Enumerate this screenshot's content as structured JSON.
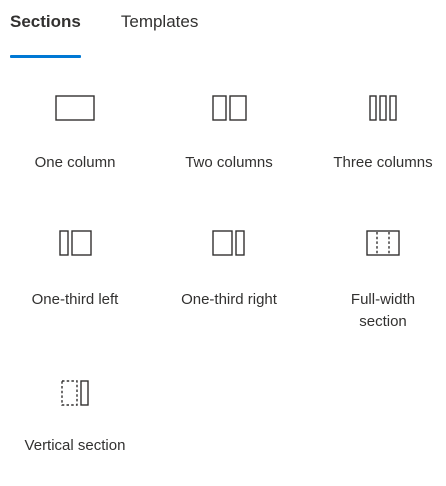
{
  "tabs": [
    {
      "label": "Sections",
      "active": true
    },
    {
      "label": "Templates",
      "active": false
    }
  ],
  "accent_color": "#0078d4",
  "tiles": [
    {
      "label": "One column",
      "icon": "one-column-icon"
    },
    {
      "label": "Two columns",
      "icon": "two-columns-icon"
    },
    {
      "label": "Three columns",
      "icon": "three-columns-icon"
    },
    {
      "label": "One-third left",
      "icon": "one-third-left-icon"
    },
    {
      "label": "One-third right",
      "icon": "one-third-right-icon"
    },
    {
      "label": "Full-width section",
      "icon": "full-width-section-icon"
    },
    {
      "label": "Vertical section",
      "icon": "vertical-section-icon"
    }
  ]
}
